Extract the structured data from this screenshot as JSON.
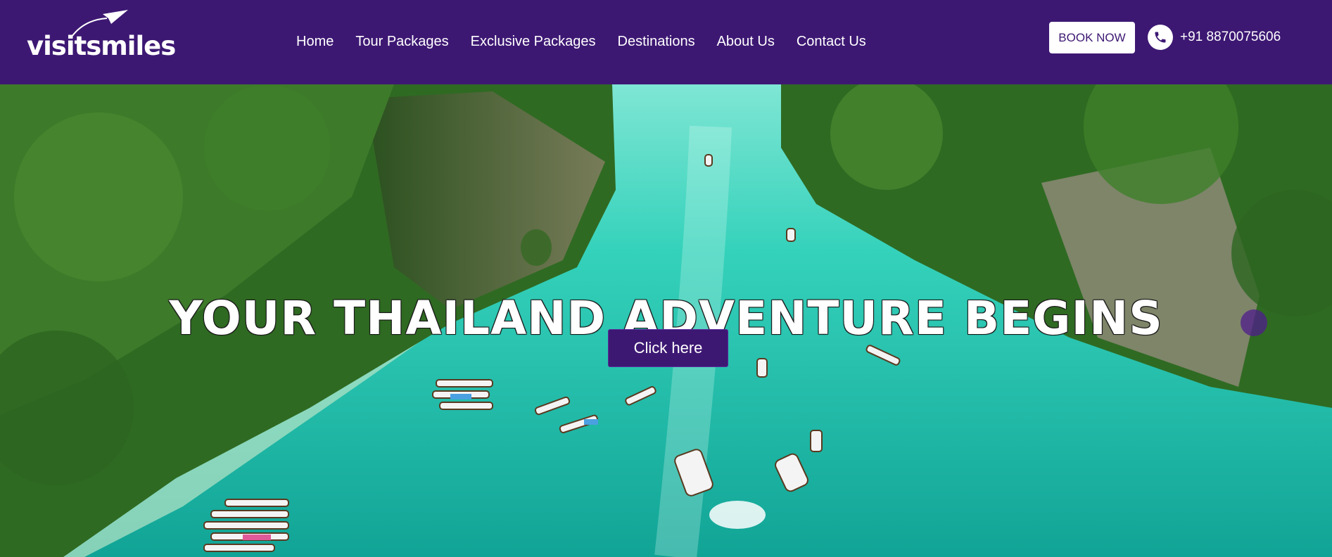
{
  "brand": {
    "logo_text": "visitsmiles"
  },
  "nav": {
    "links": [
      "Home",
      "Tour Packages",
      "Exclusive Packages",
      "Destinations",
      "About Us",
      "Contact Us"
    ]
  },
  "header": {
    "book_label": "BOOK NOW",
    "phone": "+91 8870075606",
    "phone_icon": "phone-icon"
  },
  "hero": {
    "title": "YOUR THAILAND ADVENTURE BEGINS",
    "cta_label": "Click here",
    "image_desc_icon": "island-lagoon-image"
  },
  "colors": {
    "nav_bg": "#3d1873",
    "accent": "#3d1873",
    "water": "#2fd0b8"
  }
}
